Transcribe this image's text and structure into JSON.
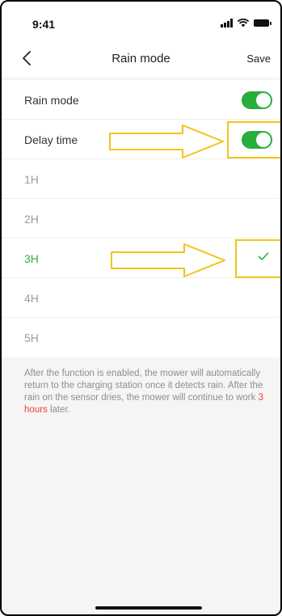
{
  "status_bar": {
    "time": "9:41"
  },
  "header": {
    "title": "Rain mode",
    "save_label": "Save"
  },
  "settings": {
    "rain_mode": {
      "label": "Rain mode",
      "enabled": true
    },
    "delay_time": {
      "label": "Delay time",
      "enabled": true
    }
  },
  "options": [
    {
      "label": "1H",
      "selected": false
    },
    {
      "label": "2H",
      "selected": false
    },
    {
      "label": "3H",
      "selected": true
    },
    {
      "label": "4H",
      "selected": false
    },
    {
      "label": "5H",
      "selected": false
    }
  ],
  "description": {
    "text": "After the function is enabled, the mower will automatically return to the charging station once it detects rain. After the rain on the sensor dries, the mower will continue to work ",
    "highlight": "3 hours",
    "suffix": " later."
  },
  "colors": {
    "accent": "#29ad3c",
    "highlight": "#e8413c",
    "annotation": "#f0c419"
  }
}
